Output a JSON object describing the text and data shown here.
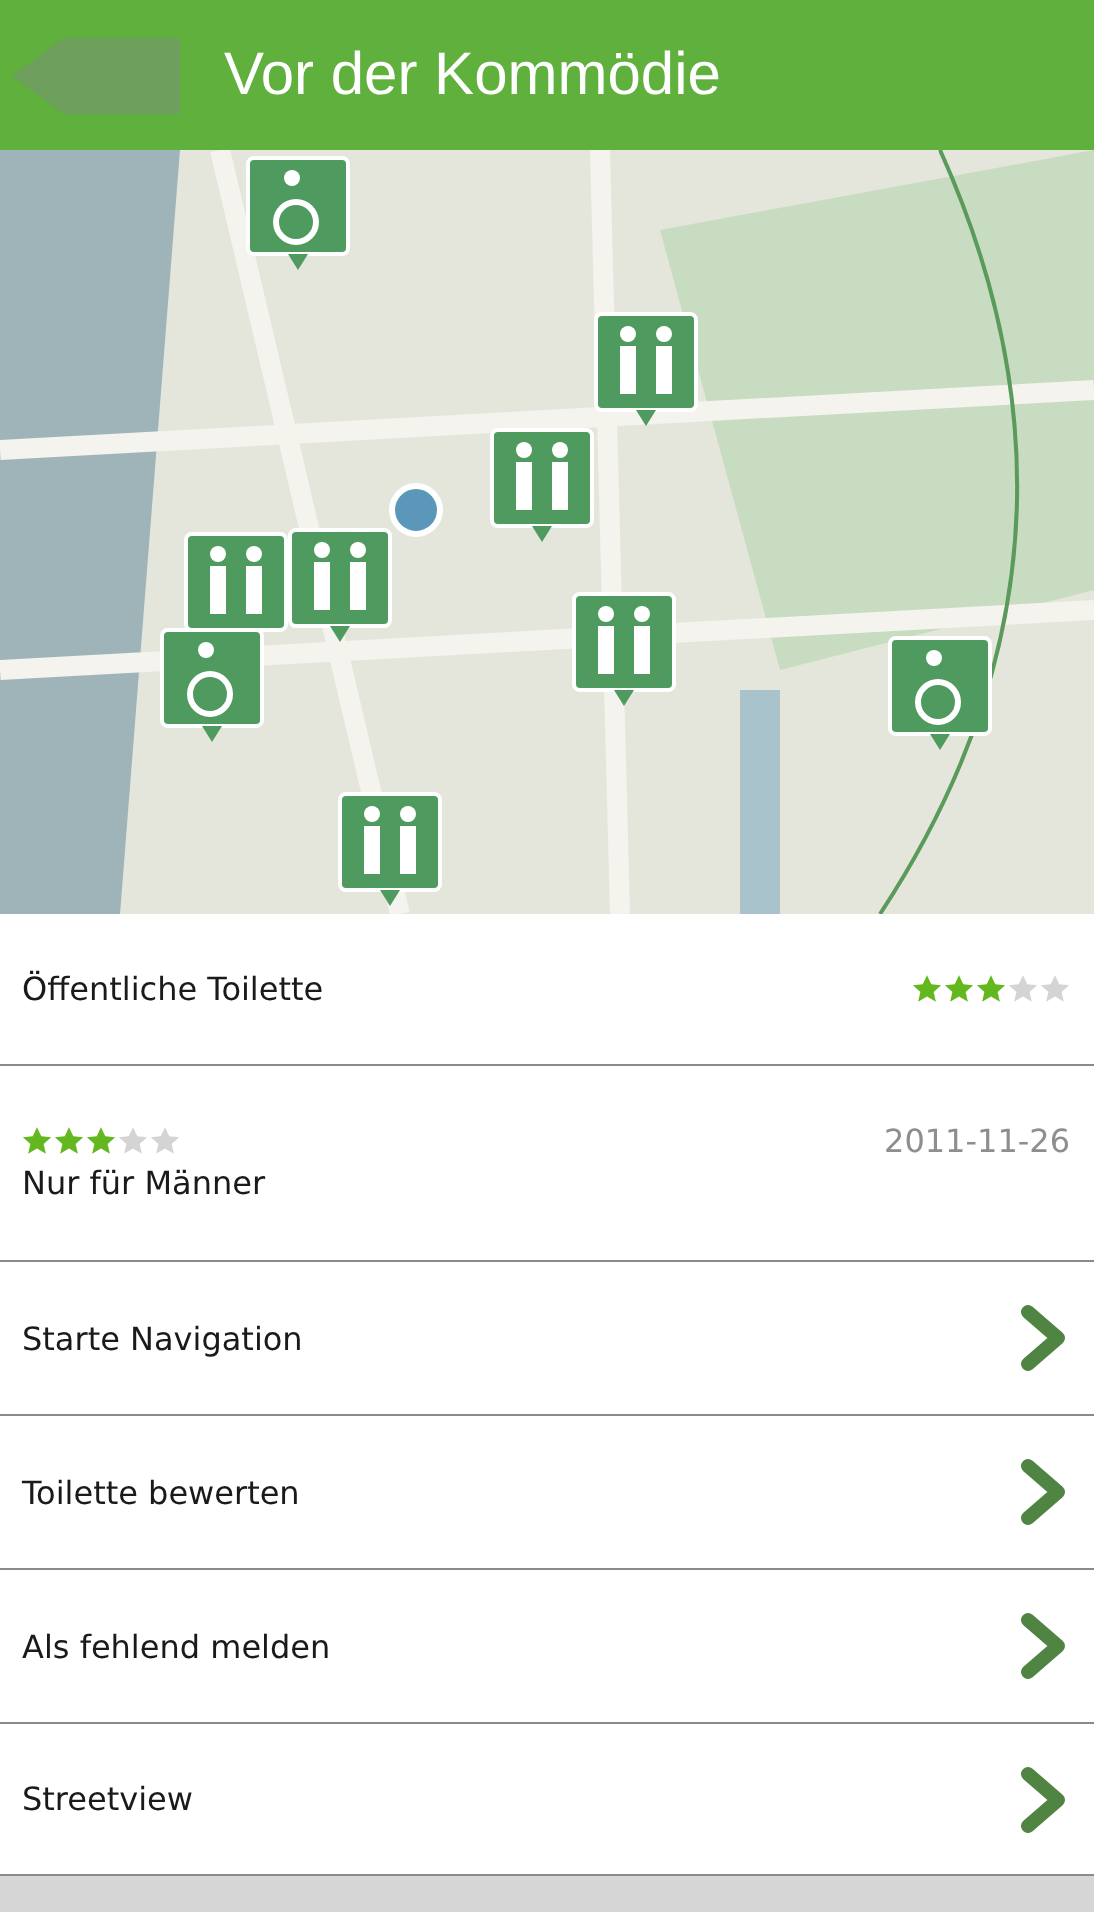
{
  "header": {
    "title": "Vor der Kommödie"
  },
  "place": {
    "name": "Öffentliche Toilette",
    "stars": 3
  },
  "review": {
    "stars": 3,
    "date": "2011-11-26",
    "text": "Nur für Männer"
  },
  "actions": [
    {
      "label": "Starte Navigation"
    },
    {
      "label": "Toilette bewerten"
    },
    {
      "label": "Als fehlend melden"
    },
    {
      "label": "Streetview"
    }
  ]
}
